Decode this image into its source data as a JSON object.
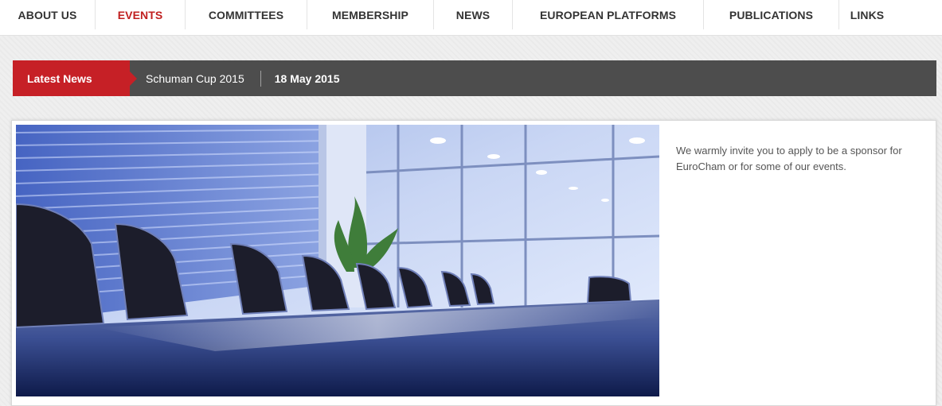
{
  "nav": {
    "items": [
      {
        "label": "ABOUT US",
        "active": false
      },
      {
        "label": "EVENTS",
        "active": true
      },
      {
        "label": "COMMITTEES",
        "active": false
      },
      {
        "label": "MEMBERSHIP",
        "active": false
      },
      {
        "label": "NEWS",
        "active": false
      },
      {
        "label": "EUROPEAN PLATFORMS",
        "active": false
      },
      {
        "label": "PUBLICATIONS",
        "active": false
      },
      {
        "label": "LINKS",
        "active": false
      }
    ],
    "active_color": "#c01f1f"
  },
  "ticker": {
    "label": "Latest News",
    "title": "Schuman Cup 2015",
    "date": "18 May 2015",
    "label_color": "#c62026",
    "bar_color": "#4d4d4d"
  },
  "feature": {
    "image": "conference-room-photo",
    "text": "We warmly invite you to apply to be a sponsor for EuroCham or for some of our events."
  }
}
